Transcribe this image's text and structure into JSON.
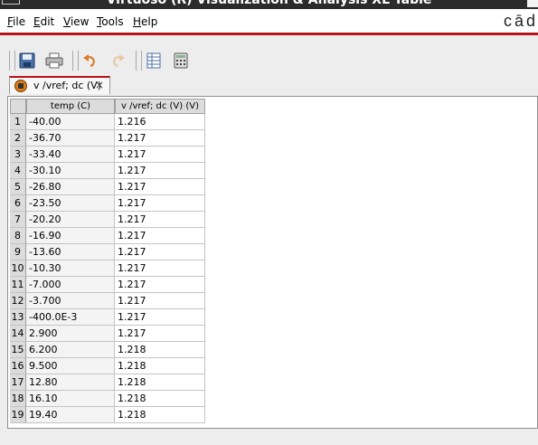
{
  "window": {
    "title": "Virtuoso (R) Visualization & Analysis XL Table",
    "brand": "cād"
  },
  "menu": [
    {
      "label": "File",
      "mnemonic": "F",
      "rest": "ile"
    },
    {
      "label": "Edit",
      "mnemonic": "E",
      "rest": "dit"
    },
    {
      "label": "View",
      "mnemonic": "V",
      "rest": "iew"
    },
    {
      "label": "Tools",
      "mnemonic": "T",
      "rest": "ools"
    },
    {
      "label": "Help",
      "mnemonic": "H",
      "rest": "elp"
    }
  ],
  "toolbar": {
    "icons": [
      "save-icon",
      "print-icon",
      "undo-icon",
      "redo-icon",
      "table-view-icon",
      "calculator-icon"
    ]
  },
  "tab": {
    "label": "v /vref; dc (V)",
    "close": "×"
  },
  "table": {
    "columns": [
      "temp (C)",
      "v /vref; dc (V) (V)"
    ],
    "rows": [
      {
        "n": "1",
        "temp": "-40.00",
        "v": "1.216"
      },
      {
        "n": "2",
        "temp": "-36.70",
        "v": "1.217"
      },
      {
        "n": "3",
        "temp": "-33.40",
        "v": "1.217"
      },
      {
        "n": "4",
        "temp": "-30.10",
        "v": "1.217"
      },
      {
        "n": "5",
        "temp": "-26.80",
        "v": "1.217"
      },
      {
        "n": "6",
        "temp": "-23.50",
        "v": "1.217"
      },
      {
        "n": "7",
        "temp": "-20.20",
        "v": "1.217"
      },
      {
        "n": "8",
        "temp": "-16.90",
        "v": "1.217"
      },
      {
        "n": "9",
        "temp": "-13.60",
        "v": "1.217"
      },
      {
        "n": "10",
        "temp": "-10.30",
        "v": "1.217"
      },
      {
        "n": "11",
        "temp": "-7.000",
        "v": "1.217"
      },
      {
        "n": "12",
        "temp": "-3.700",
        "v": "1.217"
      },
      {
        "n": "13",
        "temp": "-400.0E-3",
        "v": "1.217"
      },
      {
        "n": "14",
        "temp": "2.900",
        "v": "1.217"
      },
      {
        "n": "15",
        "temp": "6.200",
        "v": "1.218"
      },
      {
        "n": "16",
        "temp": "9.500",
        "v": "1.218"
      },
      {
        "n": "17",
        "temp": "12.80",
        "v": "1.218"
      },
      {
        "n": "18",
        "temp": "16.10",
        "v": "1.218"
      },
      {
        "n": "19",
        "temp": "19.40",
        "v": "1.218"
      }
    ]
  },
  "colors": {
    "accent": "#b8121b",
    "header_bg": "#dcdcdc",
    "titlebar_bg": "#2b2b2b"
  }
}
